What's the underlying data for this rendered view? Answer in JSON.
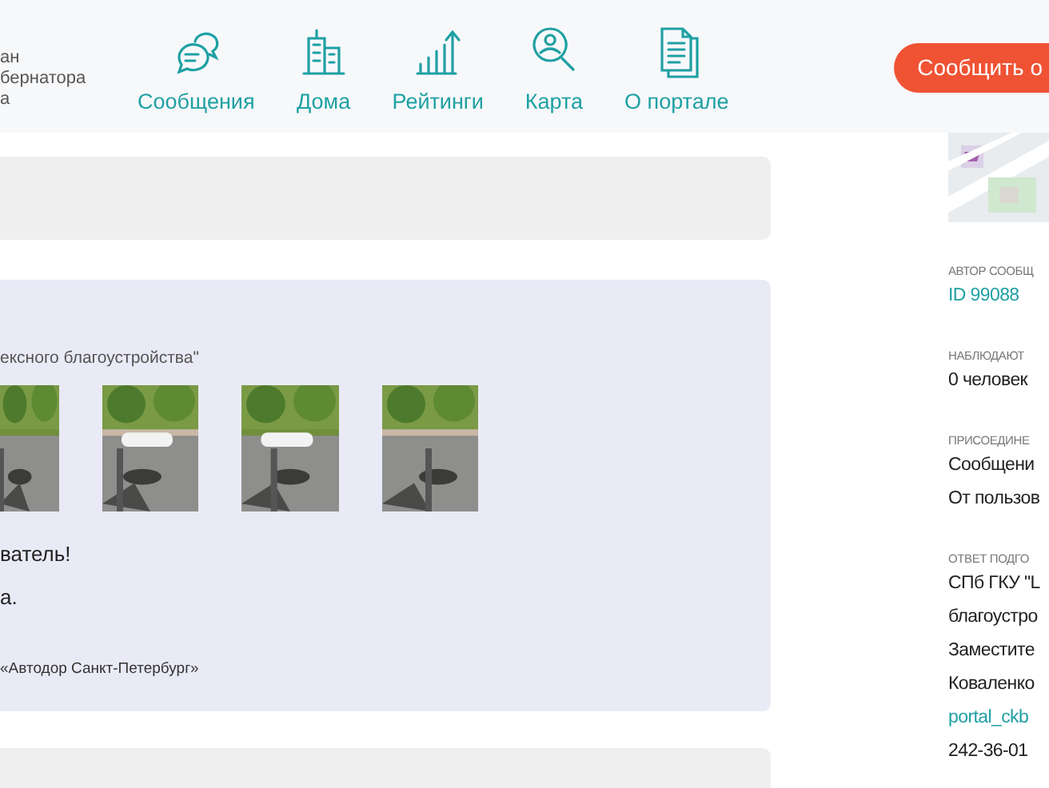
{
  "header": {
    "logo_lines": [
      "ан",
      "бернатора",
      "а"
    ],
    "nav": [
      {
        "label": "Сообщения",
        "kind": "chat"
      },
      {
        "label": "Дома",
        "kind": "building"
      },
      {
        "label": "Рейтинги",
        "kind": "chart"
      },
      {
        "label": "Карта",
        "kind": "magnifier"
      },
      {
        "label": "О портале",
        "kind": "document"
      }
    ],
    "report_button": "Сообщить о"
  },
  "message": {
    "caption": "ексного благоустройства\"",
    "greeting": "ватель!",
    "body": "а.",
    "signature": "«Автодор Санкт-Петербург»"
  },
  "sidebar": {
    "fields": [
      {
        "label": "АВТОР СООБЩ",
        "lines": [
          {
            "text": "ID 99088",
            "kind": "link"
          }
        ]
      },
      {
        "label": "НАБЛЮДАЮТ",
        "lines": [
          {
            "text": "0 человек",
            "kind": "text"
          }
        ]
      },
      {
        "label": "ПРИСОЕДИНЕ",
        "lines": [
          {
            "text": "Сообщени",
            "kind": "text"
          },
          {
            "text": "От пользов",
            "kind": "text"
          }
        ]
      },
      {
        "label": "ОТВЕТ ПОДГО",
        "lines": [
          {
            "text": "СПб ГКУ \"L",
            "kind": "text"
          },
          {
            "text": "благоустро",
            "kind": "text"
          },
          {
            "text": "Заместите",
            "kind": "text"
          },
          {
            "text": "Коваленко",
            "kind": "text"
          },
          {
            "text": "portal_ckb",
            "kind": "link"
          },
          {
            "text": "242-36-01",
            "kind": "text"
          }
        ]
      }
    ]
  }
}
